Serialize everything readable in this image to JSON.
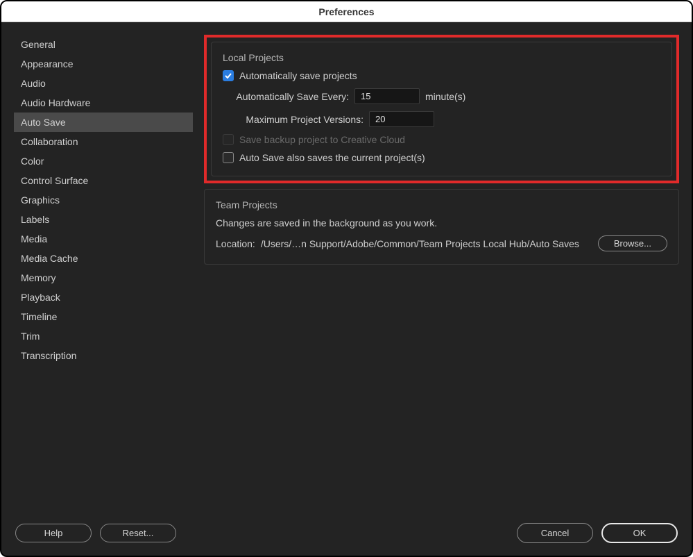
{
  "title": "Preferences",
  "sidebar": {
    "items": [
      "General",
      "Appearance",
      "Audio",
      "Audio Hardware",
      "Auto Save",
      "Collaboration",
      "Color",
      "Control Surface",
      "Graphics",
      "Labels",
      "Media",
      "Media Cache",
      "Memory",
      "Playback",
      "Timeline",
      "Trim",
      "Transcription"
    ],
    "selected_index": 4
  },
  "local": {
    "title": "Local Projects",
    "auto_save_label": "Automatically save projects",
    "auto_save_checked": true,
    "interval_label": "Automatically Save Every:",
    "interval_value": "15",
    "interval_unit": "minute(s)",
    "max_versions_label": "Maximum Project Versions:",
    "max_versions_value": "20",
    "backup_cloud_label": "Save backup project to Creative Cloud",
    "backup_cloud_checked": false,
    "also_save_current_label": "Auto Save also saves the current project(s)",
    "also_save_current_checked": false
  },
  "team": {
    "title": "Team Projects",
    "desc": "Changes are saved in the background as you work.",
    "location_label": "Location:",
    "location_value": "/Users/…n Support/Adobe/Common/Team Projects Local Hub/Auto Saves",
    "browse_label": "Browse..."
  },
  "footer": {
    "help": "Help",
    "reset": "Reset...",
    "cancel": "Cancel",
    "ok": "OK"
  }
}
